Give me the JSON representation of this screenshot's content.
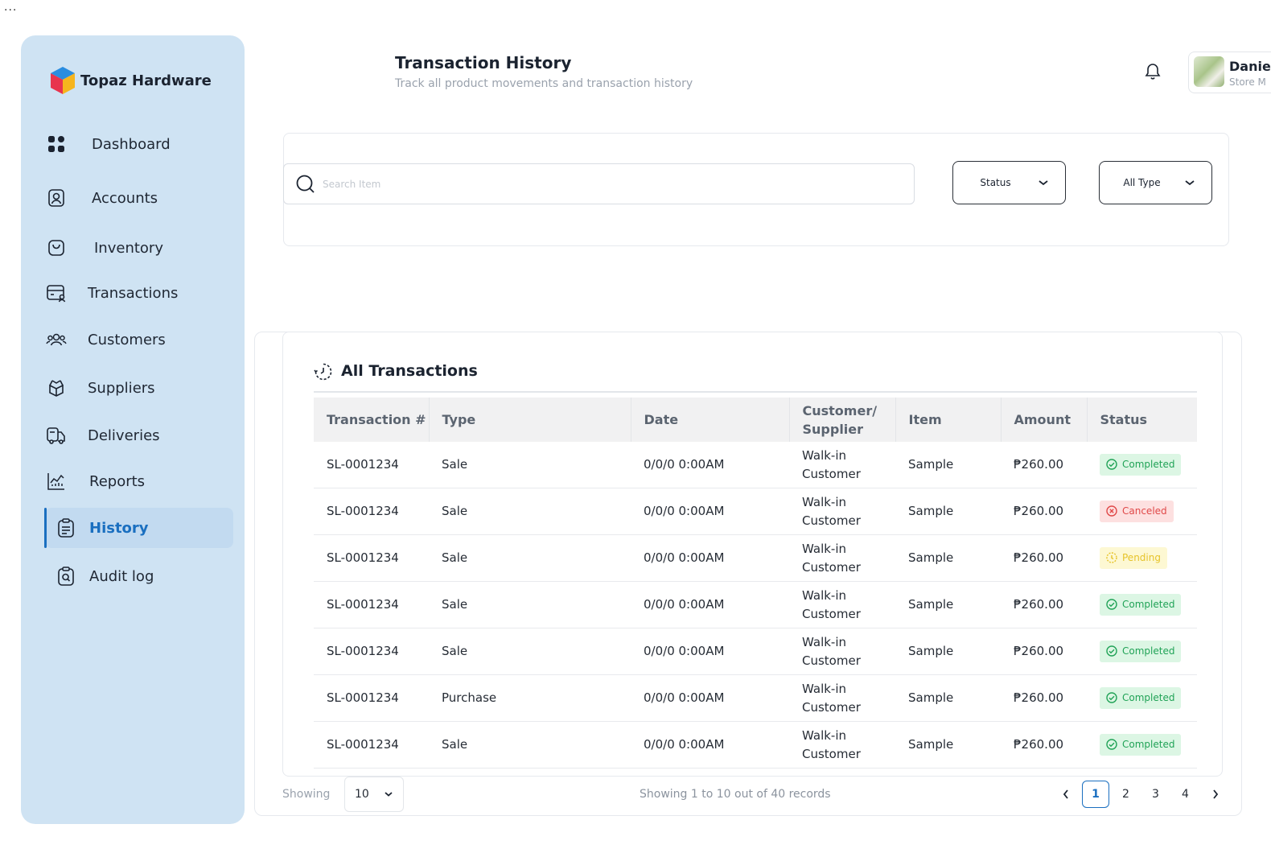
{
  "window": {
    "menu_dots": "..."
  },
  "brand": {
    "name": "Topaz Hardware"
  },
  "sidebar": {
    "items": [
      {
        "label": "Dashboard",
        "icon": "grid-icon"
      },
      {
        "label": "Accounts",
        "icon": "user-card-icon"
      },
      {
        "label": "Inventory",
        "icon": "bag-icon"
      },
      {
        "label": "Transactions",
        "icon": "transactions-icon"
      },
      {
        "label": "Customers",
        "icon": "customers-icon"
      },
      {
        "label": "Suppliers",
        "icon": "box-icon"
      },
      {
        "label": "Deliveries",
        "icon": "truck-icon"
      },
      {
        "label": "Reports",
        "icon": "chart-icon"
      },
      {
        "label": "History",
        "icon": "clipboard-icon",
        "active": true
      },
      {
        "label": "Audit log",
        "icon": "audit-icon"
      }
    ]
  },
  "header": {
    "title": "Transaction History",
    "subtitle": "Track all product movements and transaction history"
  },
  "profile": {
    "name": "Danie",
    "role": "Store M"
  },
  "filters": {
    "search_placeholder": "Search Item",
    "status_label": "Status",
    "type_label": "All Type"
  },
  "table": {
    "title": "All Transactions",
    "columns": [
      "Transaction #",
      "Type",
      "Date",
      "Customer/ Supplier",
      "Item",
      "Amount",
      "Status"
    ],
    "rows": [
      {
        "id": "SL-0001234",
        "type": "Sale",
        "date": "0/0/0 0:00AM",
        "party": "Walk-in Customer",
        "item": "Sample",
        "amount": "₱260.00",
        "status": "Completed"
      },
      {
        "id": "SL-0001234",
        "type": "Sale",
        "date": "0/0/0 0:00AM",
        "party": "Walk-in Customer",
        "item": "Sample",
        "amount": "₱260.00",
        "status": "Canceled"
      },
      {
        "id": "SL-0001234",
        "type": "Sale",
        "date": "0/0/0 0:00AM",
        "party": "Walk-in Customer",
        "item": "Sample",
        "amount": "₱260.00",
        "status": "Pending"
      },
      {
        "id": "SL-0001234",
        "type": "Sale",
        "date": "0/0/0 0:00AM",
        "party": "Walk-in Customer",
        "item": "Sample",
        "amount": "₱260.00",
        "status": "Completed"
      },
      {
        "id": "SL-0001234",
        "type": "Sale",
        "date": "0/0/0 0:00AM",
        "party": "Walk-in Customer",
        "item": "Sample",
        "amount": "₱260.00",
        "status": "Completed"
      },
      {
        "id": "SL-0001234",
        "type": "Purchase",
        "date": "0/0/0 0:00AM",
        "party": "Walk-in Customer",
        "item": "Sample",
        "amount": "₱260.00",
        "status": "Completed"
      },
      {
        "id": "SL-0001234",
        "type": "Sale",
        "date": "0/0/0 0:00AM",
        "party": "Walk-in Customer",
        "item": "Sample",
        "amount": "₱260.00",
        "status": "Completed"
      }
    ]
  },
  "footer": {
    "showing_label": "Showing",
    "page_size": "10",
    "records_text": "Showing 1 to 10 out of 40 records",
    "pages": [
      "1",
      "2",
      "3",
      "4"
    ],
    "current_page": "1"
  },
  "colors": {
    "sidebar_bg": "#cfe3f3",
    "accent": "#1a6fc0",
    "completed": "#21a357",
    "canceled": "#e04848",
    "pending": "#e6c32a"
  }
}
